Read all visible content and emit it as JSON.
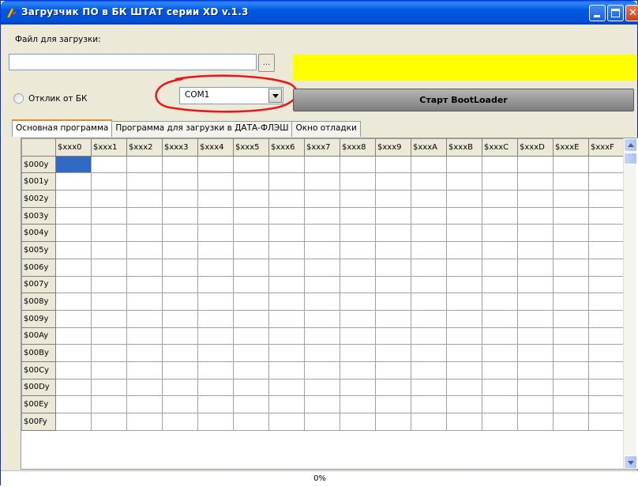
{
  "window": {
    "title": "Загрузчик ПО в БК ШТАТ серии XD v.1.3"
  },
  "file": {
    "label": "Файл для загрузки:",
    "value": "",
    "browse_label": "..."
  },
  "radio": {
    "label": "Отклик от БК",
    "checked": false
  },
  "port": {
    "selected": "COM1"
  },
  "start_button": {
    "label": "Старт BootLoader"
  },
  "tabs": [
    {
      "label": "Основная программа",
      "active": true
    },
    {
      "label": "Программа для загрузки в ДАТА-ФЛЭШ",
      "active": false
    },
    {
      "label": "Окно отладки",
      "active": false
    }
  ],
  "grid": {
    "columns": [
      "$xxx0",
      "$xxx1",
      "$xxx2",
      "$xxx3",
      "$xxx4",
      "$xxx5",
      "$xxx6",
      "$xxx7",
      "$xxx8",
      "$xxx9",
      "$xxxA",
      "$xxxB",
      "$xxxC",
      "$xxxD",
      "$xxxE",
      "$xxxF"
    ],
    "rows": [
      "$000y",
      "$001y",
      "$002y",
      "$003y",
      "$004y",
      "$005y",
      "$006y",
      "$007y",
      "$008y",
      "$009y",
      "$00Ay",
      "$00By",
      "$00Cy",
      "$00Dy",
      "$00Ey",
      "$00Fy"
    ]
  },
  "status": {
    "progress_text": "0%"
  },
  "colors": {
    "title_bar": "#0058e0",
    "status_panel": "#ffff00",
    "highlight_annotation": "#e31b1b",
    "selected_cell": "#316ac5"
  }
}
